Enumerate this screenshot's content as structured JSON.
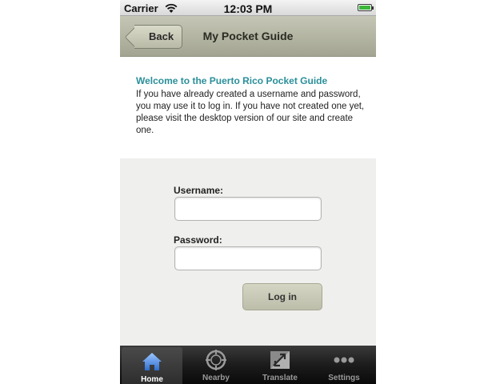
{
  "status_bar": {
    "carrier": "Carrier",
    "time": "12:03 PM",
    "battery_level": 1.0
  },
  "nav_bar": {
    "back_label": "Back",
    "title": "My Pocket Guide"
  },
  "welcome": {
    "title": "Welcome to the Puerto Rico Pocket Guide",
    "text": "If you have already created a username and password, you may use it to log in. If you have not created one yet, please visit the desktop version of our site and create one."
  },
  "login_form": {
    "username_label": "Username:",
    "username_value": "",
    "password_label": "Password:",
    "password_value": "",
    "login_button": "Log in"
  },
  "tab_bar": {
    "tabs": [
      {
        "label": "Home",
        "icon": "home-icon",
        "active": true
      },
      {
        "label": "Nearby",
        "icon": "compass-icon",
        "active": false
      },
      {
        "label": "Translate",
        "icon": "translate-icon",
        "active": false
      },
      {
        "label": "Settings",
        "icon": "more-icon",
        "active": false
      }
    ]
  },
  "colors": {
    "accent": "#2a8f9a",
    "nav_bar": "#b4b6a3",
    "tab_active_icon": "#5b8fd6"
  }
}
